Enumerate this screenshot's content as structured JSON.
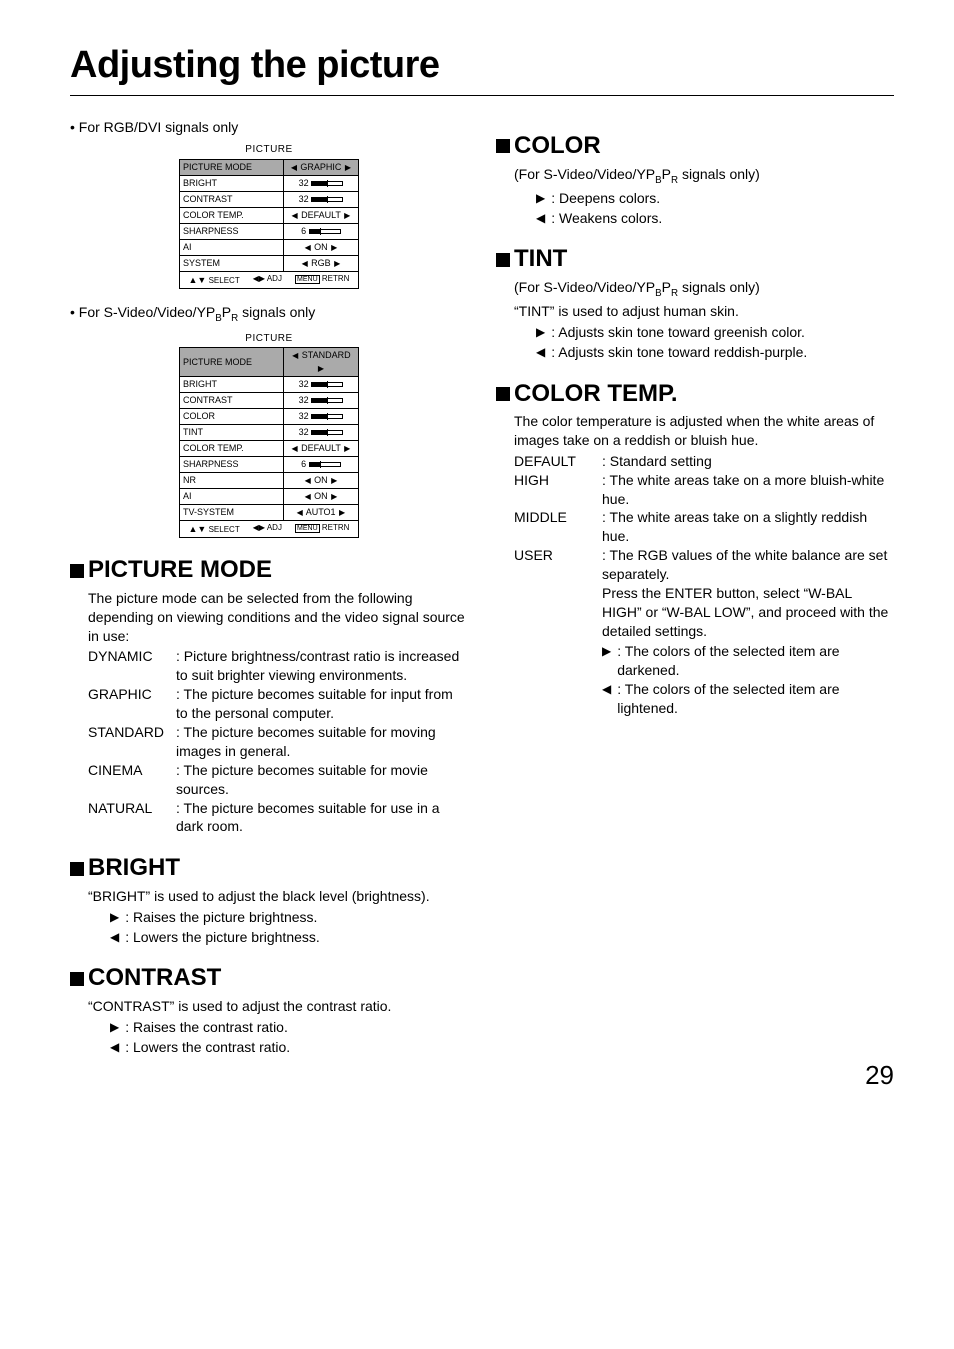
{
  "page_title": "Adjusting the picture",
  "page_number": "29",
  "left": {
    "signal_label_1": "• For RGB/DVI signals only",
    "signal_label_2": "• For S-Video/Video/YPBPR signals only",
    "osd1": {
      "title": "PICTURE",
      "rows": [
        {
          "label": "PICTURE MODE",
          "value": "GRAPHIC",
          "arrows": true,
          "hilite": true
        },
        {
          "label": "BRIGHT",
          "value": "32",
          "slider": true,
          "fill": 50
        },
        {
          "label": "CONTRAST",
          "value": "32",
          "slider": true,
          "fill": 50
        },
        {
          "label": "COLOR TEMP.",
          "value": "DEFAULT",
          "arrows": true
        },
        {
          "label": "SHARPNESS",
          "value": "6",
          "slider": true,
          "fill": 35
        },
        {
          "label": "AI",
          "value": "ON",
          "arrows": true
        },
        {
          "label": "SYSTEM",
          "value": "RGB",
          "arrows": true
        }
      ],
      "footer": {
        "select": "SELECT",
        "adj": "ADJ",
        "retrn": "RETRN"
      }
    },
    "osd2": {
      "title": "PICTURE",
      "rows": [
        {
          "label": "PICTURE MODE",
          "value": "STANDARD",
          "arrows": true,
          "hilite": true
        },
        {
          "label": "BRIGHT",
          "value": "32",
          "slider": true,
          "fill": 50
        },
        {
          "label": "CONTRAST",
          "value": "32",
          "slider": true,
          "fill": 50
        },
        {
          "label": "COLOR",
          "value": "32",
          "slider": true,
          "fill": 50
        },
        {
          "label": "TINT",
          "value": "32",
          "slider": true,
          "fill": 50
        },
        {
          "label": "COLOR TEMP.",
          "value": "DEFAULT",
          "arrows": true
        },
        {
          "label": "SHARPNESS",
          "value": "6",
          "slider": true,
          "fill": 35
        },
        {
          "label": "NR",
          "value": "ON",
          "arrows": true
        },
        {
          "label": "AI",
          "value": "ON",
          "arrows": true
        },
        {
          "label": "TV-SYSTEM",
          "value": "AUTO1",
          "arrows": true
        }
      ],
      "footer": {
        "select": "SELECT",
        "adj": "ADJ",
        "retrn": "RETRN"
      }
    },
    "picture_mode": {
      "heading": "PICTURE MODE",
      "intro": "The picture mode can be selected from the following depending on viewing conditions and the video signal source in use:",
      "items": [
        {
          "term": "DYNAMIC",
          "desc": "Picture brightness/contrast ratio is increased to suit brighter viewing environments."
        },
        {
          "term": "GRAPHIC",
          "desc": "The picture becomes suitable for input from to the personal computer."
        },
        {
          "term": "STANDARD",
          "desc": "The picture becomes suitable for moving images in general."
        },
        {
          "term": "CINEMA",
          "desc": "The picture becomes suitable for movie sources."
        },
        {
          "term": "NATURAL",
          "desc": "The picture becomes suitable for use in a dark room."
        }
      ]
    },
    "bright": {
      "heading": "BRIGHT",
      "intro": "“BRIGHT” is used to adjust the black level (brightness).",
      "right_arrow": ": Raises the picture brightness.",
      "left_arrow": ": Lowers the picture brightness."
    },
    "contrast": {
      "heading": "CONTRAST",
      "intro": "“CONTRAST” is used to adjust the contrast ratio.",
      "right_arrow": ": Raises the contrast ratio.",
      "left_arrow": ": Lowers the contrast ratio."
    }
  },
  "right": {
    "color": {
      "heading": "COLOR",
      "note": "(For S-Video/Video/YPBPR signals only)",
      "right_arrow": ": Deepens colors.",
      "left_arrow": ": Weakens colors."
    },
    "tint": {
      "heading": "TINT",
      "note": "(For S-Video/Video/YPBPR signals only)",
      "intro": "“TINT” is used to adjust human skin.",
      "right_arrow": ": Adjusts skin tone toward greenish color.",
      "left_arrow": ": Adjusts skin tone toward reddish-purple."
    },
    "color_temp": {
      "heading": "COLOR TEMP.",
      "intro": "The color temperature is adjusted when the white areas of images take on a reddish or bluish hue.",
      "items": [
        {
          "term": "DEFAULT",
          "desc": "Standard setting"
        },
        {
          "term": "HIGH",
          "desc": "The white areas take on a more bluish-white hue."
        },
        {
          "term": "MIDDLE",
          "desc": "The white areas take on a slightly reddish hue."
        },
        {
          "term": "USER",
          "desc": "The RGB values of the white balance are set separately.\nPress the ENTER button, select “W-BAL HIGH” or “W-BAL LOW”, and proceed with the detailed settings."
        }
      ],
      "sub_right": ": The colors of the selected item are darkened.",
      "sub_left": ": The colors of the selected item are lightened."
    }
  }
}
